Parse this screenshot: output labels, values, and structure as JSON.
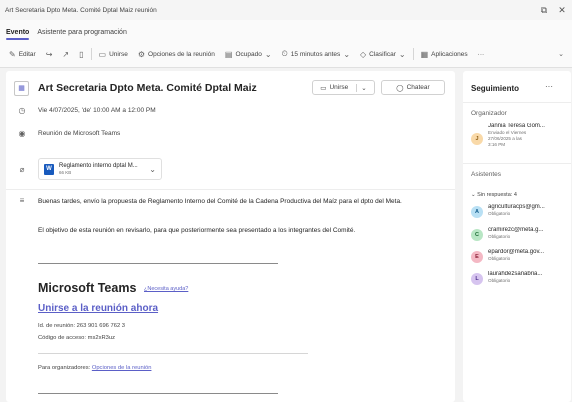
{
  "window": {
    "title": "Art Secretaria Dpto Meta. Comité Dptal Maiz reunión",
    "restore_glyph": "⧉",
    "close_glyph": "✕"
  },
  "tabs": [
    "Evento",
    "Asistente para programación"
  ],
  "toolbar": {
    "edit": "Editar",
    "join": "Unirse",
    "meeting_options": "Opciones de la reunión",
    "busy": "Ocupado",
    "reminder": "15 minutos antes",
    "categorize": "Clasificar",
    "apps": "Aplicaciones",
    "more": "···"
  },
  "event": {
    "subject": "Art Secretaria Dpto Meta. Comité Dptal Maiz",
    "join_button": "Unirse",
    "chat_button": "Chatear",
    "datetime": "Vie 4/07/2025, 'de' 10:00 AM a 12:00 PM",
    "location": "Reunión de Microsoft Teams",
    "attachment": {
      "name": "Reglamento interno dptal M...",
      "size": "66 KB"
    },
    "body": [
      "Buenas tardes, envío la propuesta de Reglamento Interno del Comité de la Cadena Productiva del Maíz para el dpto del Meta.",
      "El objetivo de esta reunión en revisarlo, para que posteriormente sea presentado a los integrantes del Comité."
    ],
    "teams_heading": "Microsoft Teams",
    "help_link": "¿Necesita ayuda?",
    "join_link": "Unirse a la reunión ahora",
    "meeting_id": "Id. de reunión: 263 901 696 762 3",
    "passcode": "Código de acceso: ms2xR3uz",
    "organizer_prefix": "Para organizadores: ",
    "organizer_link": "Opciones de la reunión"
  },
  "tracking": {
    "title": "Seguimiento",
    "more": "···",
    "organizer_label": "Organizador",
    "organizer": {
      "initial": "J",
      "name": "Jannia Teresa Gom...",
      "line1": "Enviado el Viernes",
      "line2": "27/06/2025 a las",
      "line3": "3:16 PM"
    },
    "attendees_label": "Asistentes",
    "group": "Sin respuesta: 4",
    "attendees": [
      {
        "initial": "A",
        "email": "agriculturacps@gm...",
        "status": "Obligatorio"
      },
      {
        "initial": "C",
        "email": "cramirezc@meta.g...",
        "status": "Obligatorio"
      },
      {
        "initial": "E",
        "email": "epardor@meta.gov...",
        "status": "Obligatorio"
      },
      {
        "initial": "L",
        "email": "laurahdezsanabria...",
        "status": "Obligatorio"
      }
    ]
  },
  "colors": {
    "accent": "#5b5fc7",
    "organizer_avatar": "#f9d9a8",
    "avatar_a": "#b9e0f4",
    "avatar_c": "#b8e6c4",
    "avatar_e": "#f4b8c4",
    "avatar_l": "#d6c4ef"
  }
}
